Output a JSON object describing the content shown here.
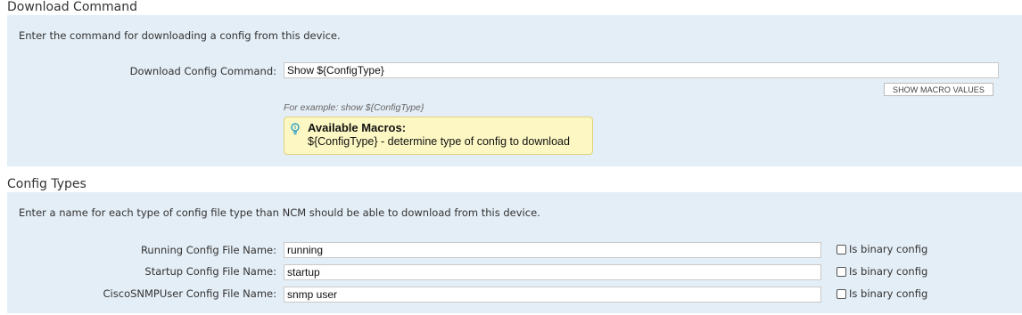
{
  "download_section": {
    "title": "Download Command",
    "description": "Enter the command for downloading a config from this device.",
    "command_label": "Download Config Command:",
    "command_value": "Show ${ConfigType}",
    "show_macro_button": "SHOW MACRO VALUES",
    "example_text": "For example: show ${ConfigType}",
    "macros_title": "Available Macros:",
    "macros_text": "${ConfigType} - determine type of config to download",
    "macro_icon": "lightbulb-icon"
  },
  "config_types_section": {
    "title": "Config Types",
    "description": "Enter a name for each type of config file type than NCM should be able to download from this device.",
    "rows": [
      {
        "label": "Running Config File Name:",
        "value": "running",
        "binary_label": "Is binary config",
        "binary_checked": false
      },
      {
        "label": "Startup Config File Name:",
        "value": "startup",
        "binary_label": "Is binary config",
        "binary_checked": false
      },
      {
        "label": "CiscoSNMPUser Config File Name:",
        "value": "snmp user",
        "binary_label": "Is binary config",
        "binary_checked": false
      }
    ]
  },
  "colors": {
    "panel_background": "#e4eef6",
    "macro_box_background": "#fdf8c3",
    "macro_box_border": "#e2d27a"
  }
}
